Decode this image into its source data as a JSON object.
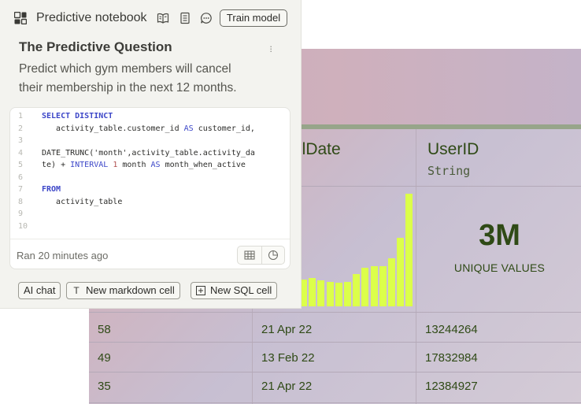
{
  "notebook": {
    "title": "Predictive notebook",
    "train_button": "Train model",
    "header_icons": [
      "book-icon",
      "document-icon",
      "chat-bubble-icon"
    ],
    "question_title": "The Predictive Question",
    "question_text": "Predict which gym members will cancel their membership in the next 12 months.",
    "more_icon": "more-vertical-icon"
  },
  "sql_cell": {
    "line_numbers": [
      "1",
      "2",
      "3",
      "4",
      "5",
      "6",
      "7",
      "8",
      "9",
      "10"
    ],
    "status": "Ran 20 minutes ago",
    "footer_icons": [
      "table-icon",
      "pie-chart-icon"
    ]
  },
  "actions": {
    "ai_chat": "AI chat",
    "new_markdown": "New markdown cell",
    "new_sql": "New SQL cell"
  },
  "data_table": {
    "columns": [
      {
        "name": "llDate",
        "type": ""
      },
      {
        "name": "UserID",
        "type": "String"
      }
    ],
    "histogram_levels": [
      0.24,
      0.25,
      0.23,
      0.22,
      0.21,
      0.22,
      0.29,
      0.34,
      0.36,
      0.36,
      0.43,
      0.61,
      1.0
    ],
    "stat_value": "3M",
    "stat_label": "UNIQUE VALUES",
    "rows": [
      [
        "58",
        "21 Apr 22",
        "13244264"
      ],
      [
        "49",
        "13 Feb 22",
        "17832984"
      ],
      [
        "35",
        "21 Apr 22",
        "12384927"
      ]
    ]
  },
  "colors": {
    "accent_bar": "#dcff4a",
    "keyword": "#3d47c8",
    "data_text": "#2f4a16"
  }
}
